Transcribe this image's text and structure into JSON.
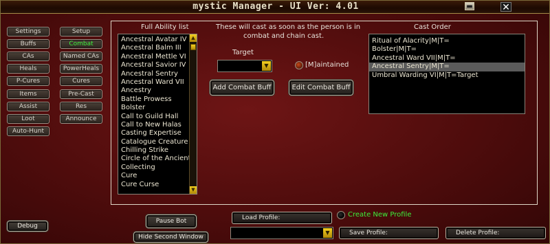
{
  "window": {
    "title": "mystic Manager   - UI Ver: 4.01"
  },
  "nav_left": [
    "Settings",
    "Buffs",
    "CAs",
    "Heals",
    "P-Cures",
    "Items",
    "Assist",
    "Loot",
    "Auto-Hunt"
  ],
  "nav_right": [
    "Setup",
    "Combat",
    "Named CAs",
    "PowerHeals",
    "Cures",
    "Pre-Cast",
    "Res",
    "Announce"
  ],
  "nav_active": "Combat",
  "ability_list": {
    "heading": "Full Ability list",
    "items": [
      "Ancestral Avatar IV",
      "Ancestral Balm III",
      "Ancestral Mettle VI",
      "Ancestral Savior IV",
      "Ancestral Sentry",
      "Ancestral Ward VII",
      "Ancestry",
      "Battle Prowess",
      "Bolster",
      "Call to Guild Hall",
      "Call to New Halas",
      "Casting Expertise",
      "Catalogue Creature",
      "Chilling Strike",
      "Circle of the Ancient",
      "Collecting",
      "Cure",
      "Cure Curse"
    ]
  },
  "center": {
    "description_line1": "These will cast as soon as the person is in",
    "description_line2": "combat and chain cast.",
    "target_label": "Target",
    "target_value": "",
    "maintained_label": "[M]aintained",
    "add_button": "Add Combat Buff",
    "edit_button": "Edit Combat Buff"
  },
  "cast_order": {
    "heading": "Cast Order",
    "items": [
      "Ritual of Alacrity|M|T=",
      "Bolster|M|T=",
      "Ancestral Ward VII|M|T=",
      "Ancestral Sentry|M|T=",
      "Umbral Warding VI|M|T=Target"
    ],
    "selected_index": 3
  },
  "bottom": {
    "debug": "Debug",
    "pause_bot": "Pause Bot",
    "hide_second_window": "Hide Second Window",
    "load_profile": "Load Profile:",
    "create_new_profile": "Create New Profile",
    "save_profile": "Save Profile:",
    "delete_profile": "Delete Profile:",
    "profile_value": ""
  },
  "colors": {
    "active_nav": "#3cf03c",
    "create_profile": "#3cf03c",
    "scroll_accent": "#e0b818"
  }
}
